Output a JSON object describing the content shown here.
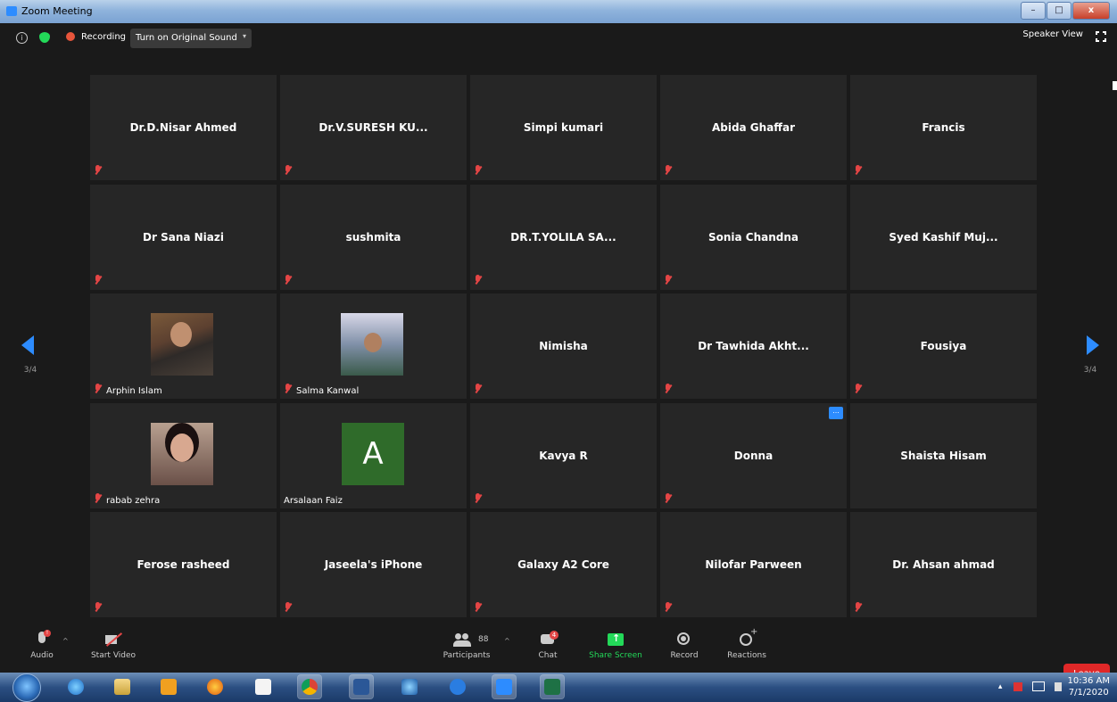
{
  "window": {
    "title": "Zoom Meeting",
    "min_glyph": "–",
    "max_glyph": "□",
    "close_glyph": "x"
  },
  "topbar": {
    "info_glyph": "i",
    "recording_label": "Recording",
    "original_sound_label": "Turn on Original Sound",
    "dropdown_glyph": "▾",
    "speaker_view_label": "Speaker View"
  },
  "pagination": {
    "left_label": "3/4",
    "right_label": "3/4"
  },
  "participants": [
    {
      "name": "Dr.D.Nisar Ahmed",
      "muted": true,
      "video": false
    },
    {
      "name": "Dr.V.SURESH  KU...",
      "muted": true,
      "video": false
    },
    {
      "name": "Simpi  kumari",
      "muted": true,
      "video": false
    },
    {
      "name": "Abida Ghaffar",
      "muted": true,
      "video": false
    },
    {
      "name": "Francis",
      "muted": true,
      "video": false
    },
    {
      "name": "Dr Sana Niazi",
      "muted": true,
      "video": false
    },
    {
      "name": "sushmita",
      "muted": true,
      "video": false
    },
    {
      "name": "DR.T.YOLILA  SA...",
      "muted": true,
      "video": false
    },
    {
      "name": "Sonia Chandna",
      "muted": true,
      "video": false
    },
    {
      "name": "Syed Kashif Muj...",
      "muted": false,
      "video": false
    },
    {
      "name": "Arphin Islam",
      "muted": true,
      "video": true
    },
    {
      "name": "Salma Kanwal",
      "muted": true,
      "video": true
    },
    {
      "name": "Nimisha",
      "muted": true,
      "video": false
    },
    {
      "name": "Dr Tawhida Akht...",
      "muted": true,
      "video": false
    },
    {
      "name": "Fousiya",
      "muted": true,
      "video": false
    },
    {
      "name": "rabab zehra",
      "muted": true,
      "video": true
    },
    {
      "name": "Arsalaan Faiz",
      "muted": false,
      "video": false,
      "avatar_letter": "A"
    },
    {
      "name": "Kavya R",
      "muted": true,
      "video": false
    },
    {
      "name": "Donna",
      "muted": true,
      "video": false,
      "more_button": true
    },
    {
      "name": "Shaista Hisam",
      "muted": false,
      "video": false
    },
    {
      "name": "Ferose rasheed",
      "muted": true,
      "video": false
    },
    {
      "name": "Jaseela's iPhone",
      "muted": true,
      "video": false
    },
    {
      "name": "Galaxy A2 Core",
      "muted": true,
      "video": false
    },
    {
      "name": "Nilofar Parween",
      "muted": true,
      "video": false
    },
    {
      "name": "Dr. Ahsan ahmad",
      "muted": true,
      "video": false
    }
  ],
  "more_button_glyph": "...",
  "toolbar": {
    "audio_label": "Audio",
    "audio_badge": "!",
    "start_video_label": "Start Video",
    "participants_label": "Participants",
    "participants_count": "88",
    "chat_label": "Chat",
    "chat_badge": "4",
    "share_screen_label": "Share Screen",
    "record_label": "Record",
    "reactions_label": "Reactions",
    "leave_label": "Leave",
    "caret_glyph": "^"
  },
  "taskbar": {
    "time": "10:36 AM",
    "date": "7/1/2020",
    "tray_glyphs": "▴"
  },
  "colors": {
    "accent": "#2d8cff",
    "leave": "#e02828",
    "share": "#23d959",
    "muted": "#e34545"
  }
}
